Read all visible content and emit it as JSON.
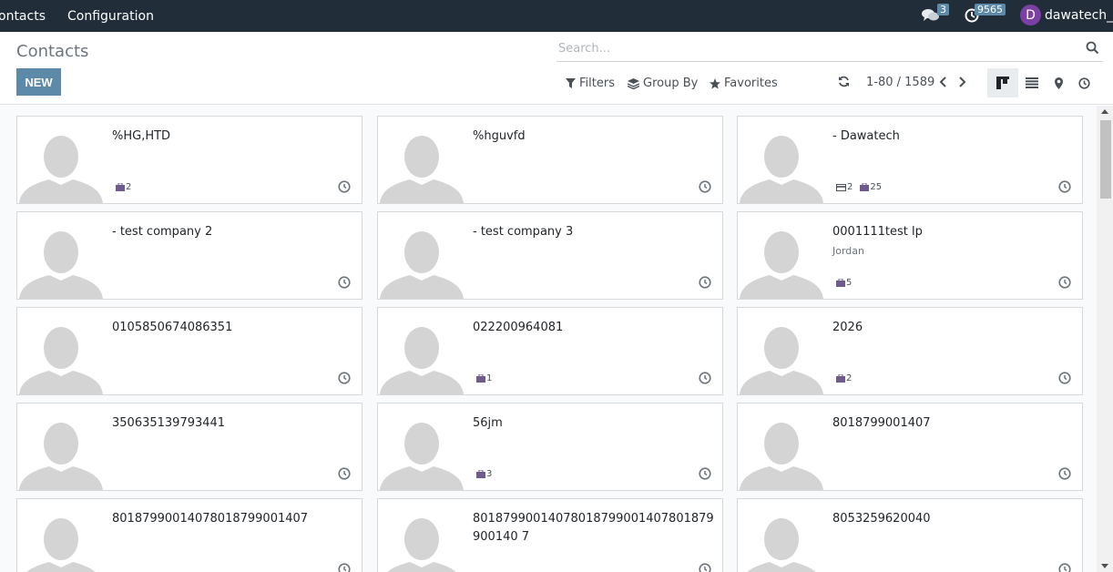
{
  "navbar": {
    "menu": [
      "ontacts",
      "Configuration"
    ],
    "messages_count": "3",
    "activities_count": "9565",
    "avatar_letter": "D",
    "username": "dawatech__"
  },
  "control": {
    "title": "Contacts",
    "new_label": "NEW",
    "search_placeholder": "Search...",
    "filters_label": "Filters",
    "groupby_label": "Group By",
    "favorites_label": "Favorites",
    "pager": "1-80 / 1589"
  },
  "cards": [
    {
      "name": "%HG,HTD",
      "sub": "",
      "tags": [
        {
          "icon": "briefcase-icon",
          "count": "2"
        }
      ]
    },
    {
      "name": "%hguvfd",
      "sub": "",
      "tags": []
    },
    {
      "name": "- Dawatech",
      "sub": "",
      "tags": [
        {
          "icon": "card-icon",
          "count": "2"
        },
        {
          "icon": "briefcase-icon",
          "count": "25"
        }
      ]
    },
    {
      "name": "- test company 2",
      "sub": "",
      "tags": []
    },
    {
      "name": "- test company 3",
      "sub": "",
      "tags": []
    },
    {
      "name": "0001111test lp",
      "sub": "Jordan",
      "tags": [
        {
          "icon": "briefcase-icon",
          "count": "5"
        }
      ]
    },
    {
      "name": "0105850674086351",
      "sub": "",
      "tags": []
    },
    {
      "name": "022200964081",
      "sub": "",
      "tags": [
        {
          "icon": "briefcase-icon",
          "count": "1"
        }
      ]
    },
    {
      "name": "2026",
      "sub": "",
      "tags": [
        {
          "icon": "briefcase-icon",
          "count": "2"
        }
      ]
    },
    {
      "name": "350635139793441",
      "sub": "",
      "tags": []
    },
    {
      "name": "56jm",
      "sub": "",
      "tags": [
        {
          "icon": "briefcase-icon",
          "count": "3"
        }
      ]
    },
    {
      "name": "8018799001407",
      "sub": "",
      "tags": []
    },
    {
      "name": "80187990014078018799001407",
      "sub": "",
      "tags": []
    },
    {
      "name": "80187990014078018799001407801879900140 7",
      "sub": "",
      "tags": []
    },
    {
      "name": "8053259620040",
      "sub": "",
      "tags": []
    }
  ],
  "colors": {
    "navbar": "#212e39",
    "primary": "#5c8aa8",
    "avatar": "#7b3fa5",
    "tag_icon": "#6f5a8e"
  }
}
